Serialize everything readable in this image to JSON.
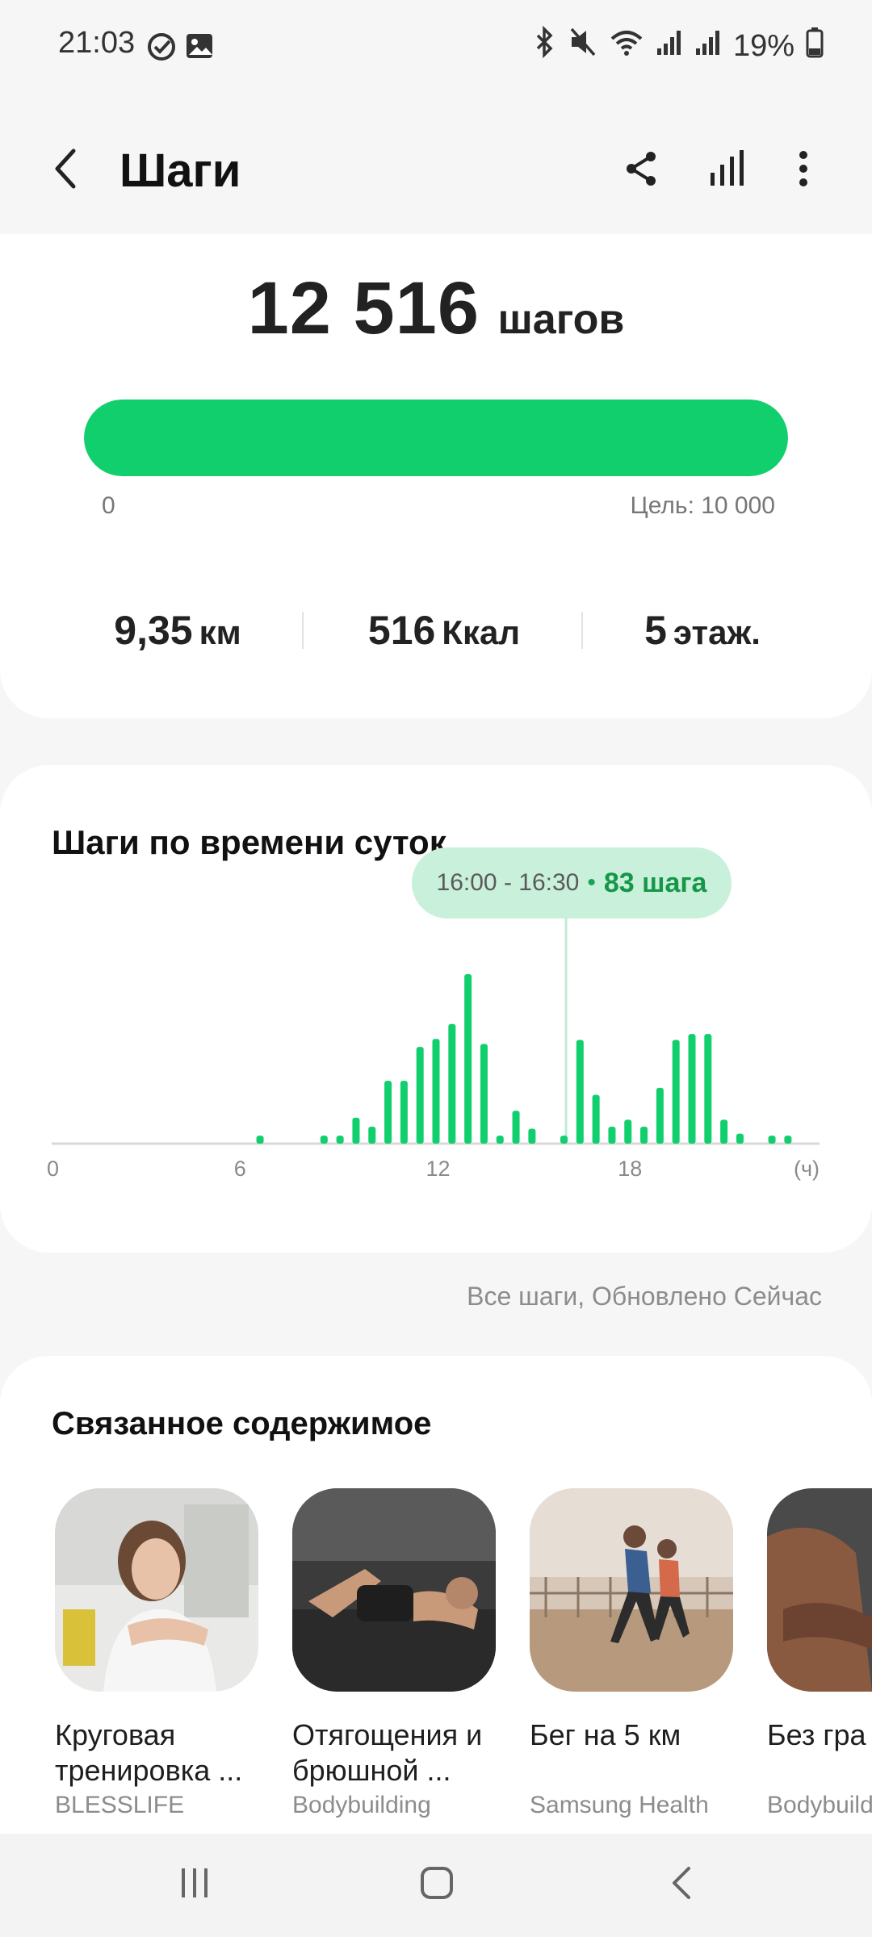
{
  "status_bar": {
    "time": "21:03",
    "battery": "19%",
    "icons": [
      "check-circle-icon",
      "image-icon",
      "bluetooth-icon",
      "mute-icon",
      "wifi-icon",
      "signal-icon",
      "signal-icon",
      "battery-icon"
    ]
  },
  "header": {
    "title": "Шаги",
    "icons": [
      "back-icon",
      "share-icon",
      "bar-chart-icon",
      "more-vertical-icon"
    ]
  },
  "summary": {
    "steps": "12 516",
    "steps_unit": "шагов",
    "progress_min": "0",
    "progress_goal": "Цель: 10 000",
    "progress_fraction": 1.0,
    "accent_color": "#12cf6d",
    "stats": [
      {
        "value": "9,35",
        "unit": "км"
      },
      {
        "value": "516",
        "unit": "Ккал"
      },
      {
        "value": "5",
        "unit": "этаж."
      }
    ]
  },
  "chart_card": {
    "title": "Шаги по времени суток",
    "tooltip_range": "16:00 - 16:30",
    "tooltip_dot": "•",
    "tooltip_value": "83 шага"
  },
  "chart_data": {
    "type": "bar",
    "x_unit": "(ч)",
    "x_ticks": [
      "0",
      "6",
      "12",
      "18"
    ],
    "xlim": [
      0,
      24
    ],
    "selected_half_hour": 16.0,
    "bar_color": "#12cf6d",
    "x": [
      6.5,
      8.5,
      9.0,
      9.5,
      10.0,
      10.5,
      11.0,
      11.5,
      12.0,
      12.5,
      13.0,
      13.5,
      14.0,
      14.5,
      15.0,
      16.0,
      16.5,
      17.0,
      17.5,
      18.0,
      18.5,
      19.0,
      19.5,
      20.0,
      20.5,
      21.0,
      21.5,
      22.5,
      23.0
    ],
    "values": [
      8,
      8,
      8,
      26,
      17,
      63,
      63,
      97,
      105,
      120,
      170,
      100,
      8,
      33,
      15,
      8,
      104,
      49,
      17,
      24,
      17,
      56,
      104,
      110,
      110,
      24,
      10,
      8,
      8
    ]
  },
  "caption": "Все шаги, Обновлено Сейчас",
  "related": {
    "title": "Связанное содержимое",
    "items": [
      {
        "title": "Круговая тренировка ...",
        "subtitle": "BLESSLIFE"
      },
      {
        "title": "Отягощения и брюшной ...",
        "subtitle": "Bodybuilding"
      },
      {
        "title": "Бег на 5 км",
        "subtitle": "Samsung Health"
      },
      {
        "title": "Без гра",
        "subtitle": "Bodybuild"
      }
    ]
  },
  "nav": {
    "icons": [
      "recent-apps-icon",
      "home-icon",
      "back-nav-icon"
    ]
  }
}
